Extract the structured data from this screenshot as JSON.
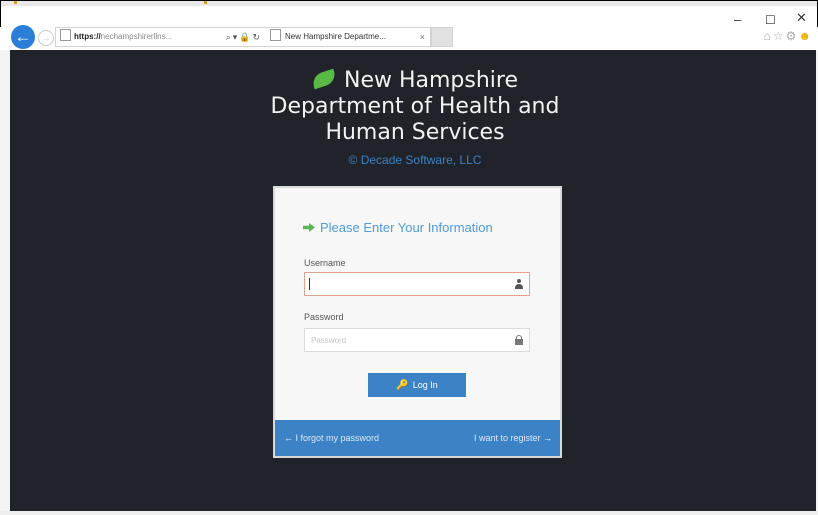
{
  "browser": {
    "url_scheme": "https://",
    "url_rest": "nechampshirerllns...",
    "tab_title": "New Hampshire Departme...",
    "tab_close": "×",
    "window_min": "–",
    "window_max": "☐",
    "window_close": "✕",
    "back": "←",
    "forward": "→"
  },
  "site": {
    "title": "New Hampshire Department of Health and Human Services",
    "copyright": "© Decade Software, LLC"
  },
  "login": {
    "heading": "Please Enter Your Information",
    "username_label": "Username",
    "username_value": "",
    "username_placeholder": "",
    "password_label": "Password",
    "password_placeholder": "Password",
    "login_button": "Log In",
    "forgot_password": "I forgot my password",
    "register": "I want to register"
  },
  "colors": {
    "page_background": "#20232a",
    "accent_blue": "#3b82c6",
    "leaf_green": "#58b947",
    "card_background": "#f7f7f7"
  }
}
